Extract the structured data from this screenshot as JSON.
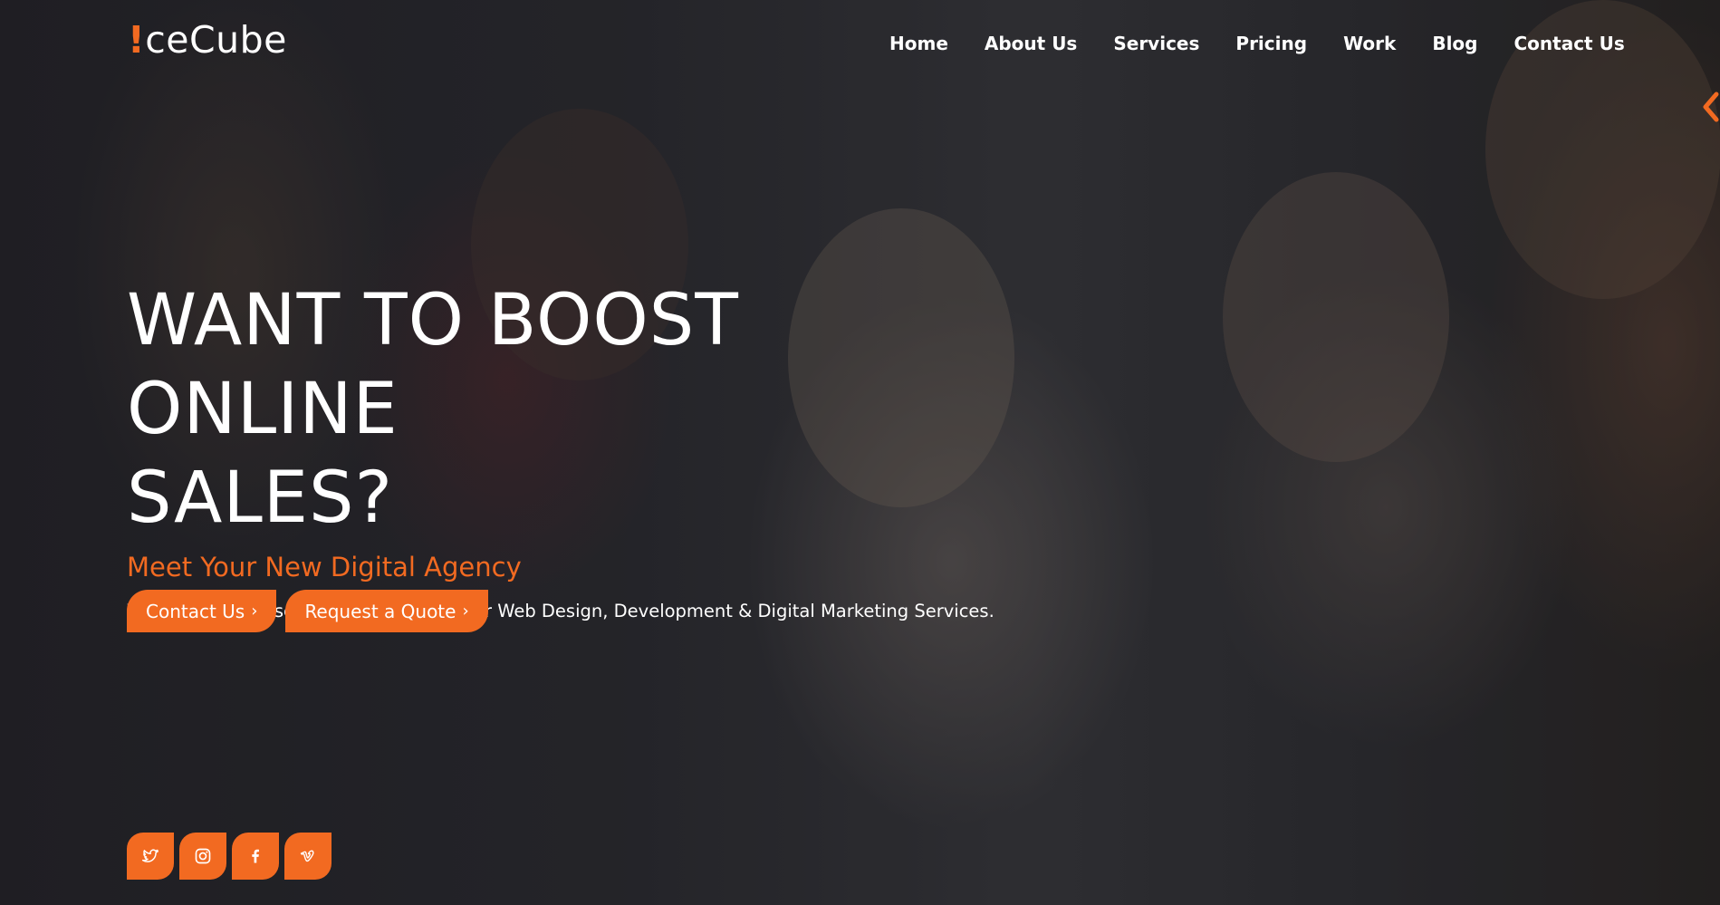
{
  "brand": {
    "logo_mark": "!",
    "logo_text": "ceCube"
  },
  "nav": {
    "items": [
      {
        "label": "Home"
      },
      {
        "label": "About Us"
      },
      {
        "label": "Services"
      },
      {
        "label": "Pricing"
      },
      {
        "label": "Work"
      },
      {
        "label": "Blog"
      },
      {
        "label": "Contact Us"
      }
    ]
  },
  "hero": {
    "headline_line1": "WANT TO BOOST ONLINE",
    "headline_line2": "SALES?",
    "subtitle": "Meet Your New Digital Agency",
    "description": "We Help Businesses To Succeed With Our Web Design, Development & Digital Marketing Services.",
    "buttons": [
      {
        "label": "Contact Us",
        "icon": "chevron-right-icon"
      },
      {
        "label": "Request a Quote",
        "icon": "chevron-right-icon"
      }
    ]
  },
  "socials": [
    "twitter-icon",
    "instagram-icon",
    "facebook-icon",
    "vimeo-icon"
  ],
  "side_control": {
    "icon": "chevron-left-icon"
  },
  "colors": {
    "accent": "#f26a21",
    "text": "#ffffff",
    "overlay": "#1e1e22"
  }
}
